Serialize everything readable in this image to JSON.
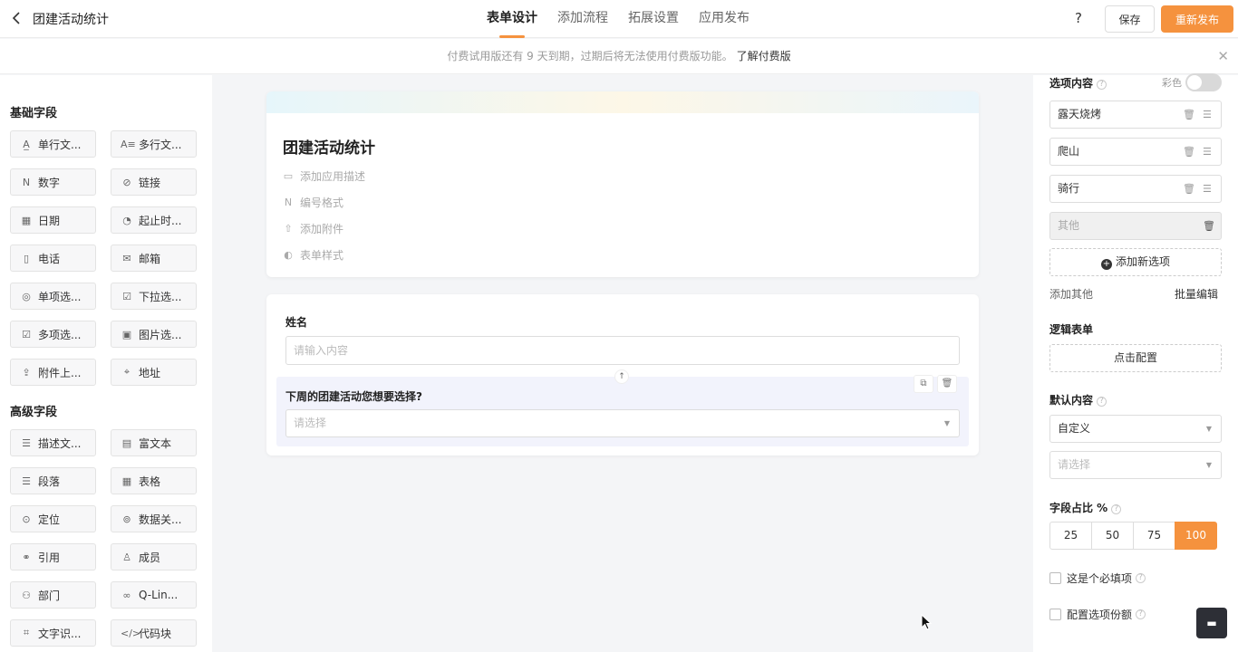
{
  "header": {
    "title": "团建活动统计",
    "tabs": [
      "表单设计",
      "添加流程",
      "拓展设置",
      "应用发布"
    ],
    "help": "?",
    "save_label": "保存",
    "publish_label": "重新发布"
  },
  "notice": {
    "text": "付费试用版还有 9 天到期，过期后将无法使用付费版功能。",
    "link": "了解付费版",
    "close": "✕"
  },
  "left_panel": {
    "basic_title": "基础字段",
    "basic_fields": [
      {
        "icon": "text-line-icon",
        "glyph": "A̲",
        "label": "单行文..."
      },
      {
        "icon": "text-multiline-icon",
        "glyph": "A≡",
        "label": "多行文..."
      },
      {
        "icon": "number-icon",
        "glyph": "N",
        "label": "数字"
      },
      {
        "icon": "link-icon",
        "glyph": "⊘",
        "label": "链接"
      },
      {
        "icon": "calendar-icon",
        "glyph": "▦",
        "label": "日期"
      },
      {
        "icon": "date-range-icon",
        "glyph": "◔",
        "label": "起止时..."
      },
      {
        "icon": "phone-icon",
        "glyph": "▯",
        "label": "电话"
      },
      {
        "icon": "mail-icon",
        "glyph": "✉",
        "label": "邮箱"
      },
      {
        "icon": "radio-icon",
        "glyph": "◎",
        "label": "单项选..."
      },
      {
        "icon": "dropdown-icon",
        "glyph": "☑",
        "label": "下拉选..."
      },
      {
        "icon": "checkbox-icon",
        "glyph": "☑",
        "label": "多项选..."
      },
      {
        "icon": "image-icon",
        "glyph": "▣",
        "label": "图片选..."
      },
      {
        "icon": "upload-icon",
        "glyph": "⇪",
        "label": "附件上..."
      },
      {
        "icon": "location-icon",
        "glyph": "⌖",
        "label": "地址"
      }
    ],
    "advanced_title": "高级字段",
    "advanced_fields": [
      {
        "icon": "description-icon",
        "glyph": "☰",
        "label": "描述文..."
      },
      {
        "icon": "rich-text-icon",
        "glyph": "▤",
        "label": "富文本"
      },
      {
        "icon": "paragraph-icon",
        "glyph": "☰",
        "label": "段落"
      },
      {
        "icon": "table-icon",
        "glyph": "▦",
        "label": "表格"
      },
      {
        "icon": "position-icon",
        "glyph": "⊙",
        "label": "定位"
      },
      {
        "icon": "data-relation-icon",
        "glyph": "⊚",
        "label": "数据关..."
      },
      {
        "icon": "quote-icon",
        "glyph": "⚭",
        "label": "引用"
      },
      {
        "icon": "member-icon",
        "glyph": "♙",
        "label": "成员"
      },
      {
        "icon": "department-icon",
        "glyph": "⚇",
        "label": "部门"
      },
      {
        "icon": "q-link-icon",
        "glyph": "∞",
        "label": "Q-Lin..."
      },
      {
        "icon": "ocr-icon",
        "glyph": "⌗",
        "label": "文字识..."
      },
      {
        "icon": "code-icon",
        "glyph": "</>",
        "label": "代码块"
      }
    ]
  },
  "form": {
    "title": "团建活动统计",
    "meta": [
      {
        "icon": "comment-icon",
        "glyph": "▭",
        "label": "添加应用描述"
      },
      {
        "icon": "number-format-icon",
        "glyph": "N",
        "label": "编号格式"
      },
      {
        "icon": "upload-icon",
        "glyph": "⇧",
        "label": "添加附件"
      },
      {
        "icon": "palette-icon",
        "glyph": "◐",
        "label": "表单样式"
      }
    ],
    "q1": {
      "label": "姓名",
      "placeholder": "请输入内容"
    },
    "q2": {
      "label": "下周的团建活动您想要选择?",
      "placeholder": "请选择"
    }
  },
  "right_panel": {
    "options_title": "选项内容",
    "color_label": "彩色",
    "options": [
      "露天烧烤",
      "爬山",
      "骑行"
    ],
    "other_option": "其他",
    "add_option": "添加新选项",
    "add_other": "添加其他",
    "batch_edit": "批量编辑",
    "logic_title": "逻辑表单",
    "logic_btn": "点击配置",
    "default_title": "默认内容",
    "default_select": "自定义",
    "default_placeholder": "请选择",
    "width_title": "字段占比 %",
    "width_options": [
      "25",
      "50",
      "75",
      "100"
    ],
    "width_selected": "100",
    "required_label": "这是个必填项",
    "quota_label": "配置选项份额"
  },
  "colors": {
    "accent": "#f5923e",
    "highlight": "#f2f3fc"
  }
}
